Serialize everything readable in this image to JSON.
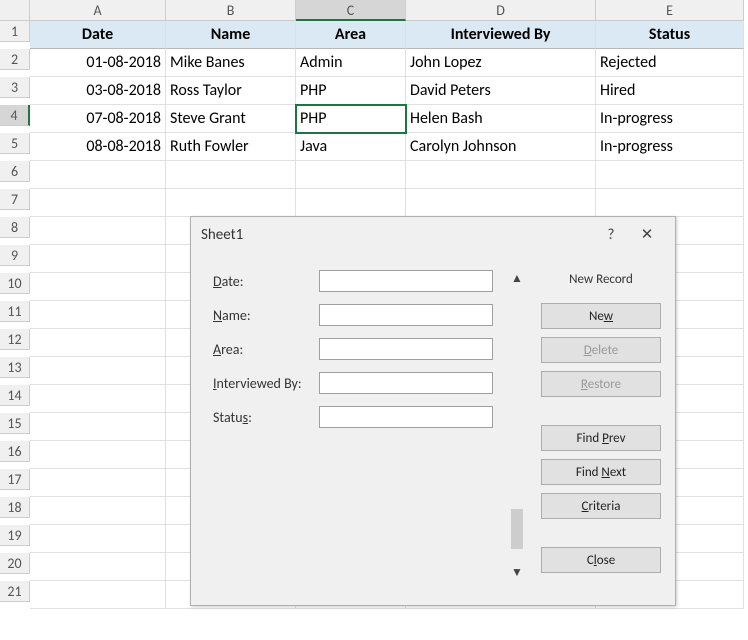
{
  "columns": [
    "A",
    "B",
    "C",
    "D",
    "E"
  ],
  "rowNumbers": [
    "1",
    "2",
    "3",
    "4",
    "5",
    "6",
    "7",
    "8",
    "9",
    "10",
    "11",
    "12",
    "13",
    "14",
    "15",
    "16",
    "17",
    "18",
    "19",
    "20",
    "21"
  ],
  "activeCol": 2,
  "activeRow": 3,
  "headers": {
    "A": "Date",
    "B": "Name",
    "C": "Area",
    "D": "Interviewed By",
    "E": "Status"
  },
  "rows": [
    {
      "A": "01-08-2018",
      "B": "Mike Banes",
      "C": "Admin",
      "D": "John Lopez",
      "E": "Rejected"
    },
    {
      "A": "03-08-2018",
      "B": "Ross Taylor",
      "C": "PHP",
      "D": "David Peters",
      "E": "Hired"
    },
    {
      "A": "07-08-2018",
      "B": "Steve Grant",
      "C": "PHP",
      "D": "Helen Bash",
      "E": "In-progress"
    },
    {
      "A": "08-08-2018",
      "B": "Ruth Fowler",
      "C": "Java",
      "D": "Carolyn Johnson",
      "E": "In-progress"
    }
  ],
  "dialog": {
    "title": "Sheet1",
    "help": "?",
    "close": "✕",
    "recordLabel": "New Record",
    "fields": [
      {
        "label_pre": "",
        "u": "D",
        "label_post": "ate:",
        "value": ""
      },
      {
        "label_pre": "",
        "u": "N",
        "label_post": "ame:",
        "value": ""
      },
      {
        "label_pre": "",
        "u": "A",
        "label_post": "rea:",
        "value": ""
      },
      {
        "label_pre": "",
        "u": "I",
        "label_post": "nterviewed By:",
        "value": ""
      },
      {
        "label_pre": "Statu",
        "u": "s",
        "label_post": ":",
        "value": ""
      }
    ],
    "buttons": {
      "new": {
        "pre": "Ne",
        "u": "w",
        "post": "",
        "enabled": true
      },
      "delete": {
        "pre": "",
        "u": "D",
        "post": "elete",
        "enabled": false
      },
      "restore": {
        "pre": "",
        "u": "R",
        "post": "estore",
        "enabled": false
      },
      "findPrev": {
        "pre": "Find ",
        "u": "P",
        "post": "rev",
        "enabled": true
      },
      "findNext": {
        "pre": "Find ",
        "u": "N",
        "post": "ext",
        "enabled": true
      },
      "criteria": {
        "pre": "",
        "u": "C",
        "post": "riteria",
        "enabled": true
      },
      "close": {
        "pre": "C",
        "u": "l",
        "post": "ose",
        "enabled": true
      }
    }
  }
}
